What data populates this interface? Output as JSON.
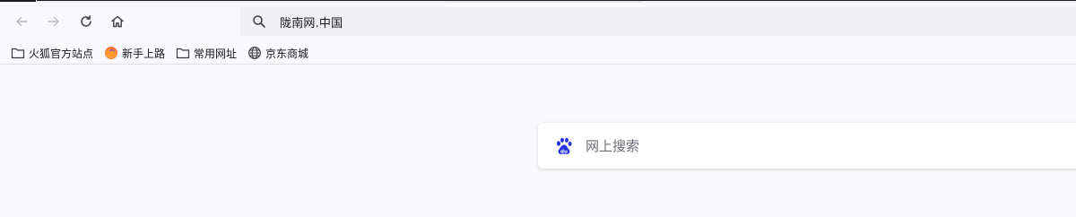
{
  "toolbar": {
    "back_icon": "arrow-left-icon",
    "forward_icon": "arrow-right-icon",
    "reload_icon": "reload-icon",
    "home_icon": "home-icon"
  },
  "urlbar": {
    "icon": "search-icon",
    "value": "陇南网.中国"
  },
  "bookmarks": [
    {
      "label": "火狐官方站点",
      "icon": "folder-icon"
    },
    {
      "label": "新手上路",
      "icon": "firefox-icon"
    },
    {
      "label": "常用网址",
      "icon": "folder-icon"
    },
    {
      "label": "京东商城",
      "icon": "globe-icon"
    }
  ],
  "newtab": {
    "search_engine_icon": "baidu-paw-icon",
    "search_placeholder": "网上搜索"
  },
  "colors": {
    "background": "#f9f9fb",
    "urlbar_bg": "#f0f0f4",
    "baidu_blue": "#2932e1",
    "firefox_orange": "#ff7139"
  }
}
